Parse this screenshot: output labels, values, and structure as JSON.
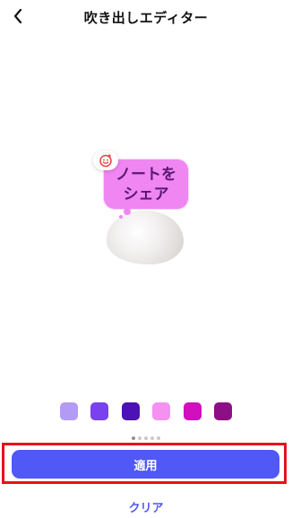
{
  "header": {
    "title": "吹き出しエディター",
    "back_icon": "chevron-left-icon"
  },
  "preview": {
    "bubble_line1": "ノートを",
    "bubble_line2": "シェア",
    "bubble_color": "#f086f2",
    "emoji_icon": "smile-icon",
    "emoji_color": "#e8423f"
  },
  "palette": {
    "colors": [
      "#b39bf4",
      "#7a42ee",
      "#4c12b6",
      "#f491f1",
      "#d10fbf",
      "#8c0f85"
    ]
  },
  "pager": {
    "count": 5,
    "active_index": 0
  },
  "actions": {
    "apply_label": "適用",
    "clear_label": "クリア",
    "accent_color": "#5058f5",
    "highlight_color": "#e8101b"
  }
}
